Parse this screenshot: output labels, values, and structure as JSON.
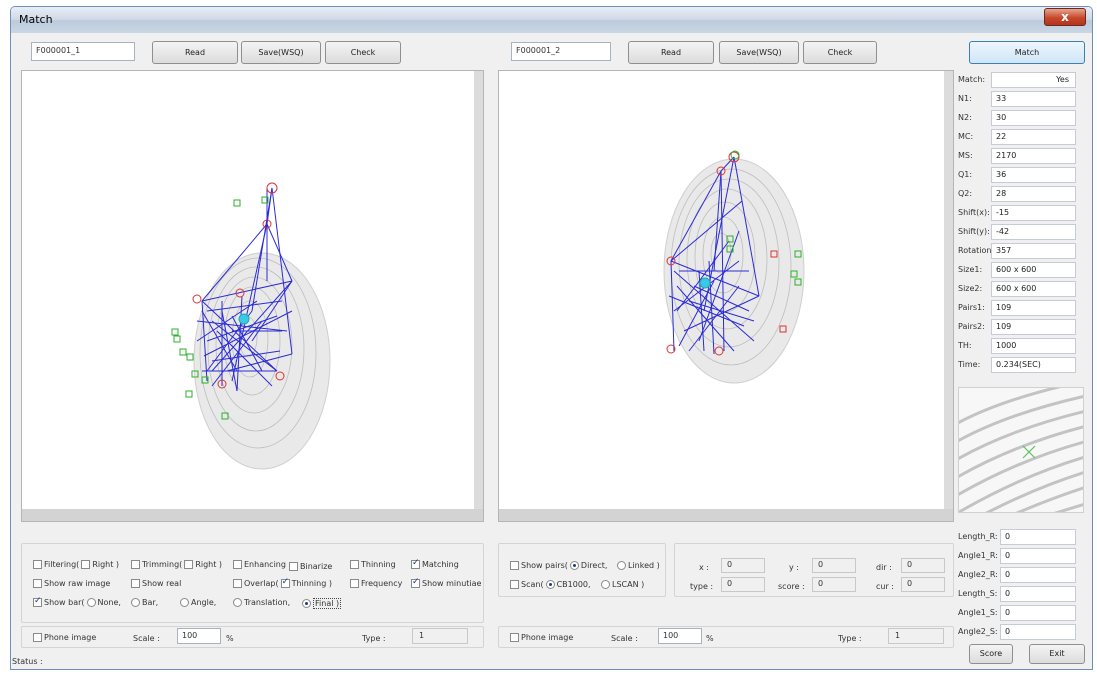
{
  "window": {
    "title": "Match",
    "close_label": "x"
  },
  "left": {
    "filename": "F000001_1",
    "read_label": "Read",
    "save_label": "Save(WSQ)",
    "check_label": "Check",
    "options": {
      "filtering": "Filtering(",
      "filtering_right": "Right )",
      "trimming": "Trimming(",
      "trimming_right": "Right )",
      "enhancing": "Enhancing",
      "binarize": "Binarize",
      "thinning": "Thinning",
      "matching": "Matching",
      "show_raw": "Show raw image",
      "show_real": "Show real",
      "overlap": "Overlap(",
      "overlap_thinning": "Thinning )",
      "frequency": "Frequency",
      "show_minutiae": "Show minutiae",
      "show_bar": "Show bar(",
      "none": "None,",
      "bar": "Bar,",
      "angle": "Angle,",
      "translation": "Translation,",
      "final": "Final )"
    },
    "phone_image": "Phone image",
    "scale_label": "Scale :",
    "scale_value": "100",
    "scale_unit": "%",
    "type_label": "Type :",
    "type_value": "1"
  },
  "right": {
    "filename": "F000001_2",
    "read_label": "Read",
    "save_label": "Save(WSQ)",
    "check_label": "Check",
    "show_pairs": "Show pairs(",
    "direct": "Direct,",
    "linked": "Linked )",
    "scan": "Scan(",
    "cb1000": "CB1000,",
    "lscan": "LSCAN )",
    "x_label": "x :",
    "x_value": "0",
    "y_label": "y :",
    "y_value": "0",
    "dir_label": "dir :",
    "dir_value": "0",
    "type_label2": "type :",
    "type_value2": "0",
    "score_label": "score :",
    "score_value": "0",
    "cur_label": "cur :",
    "cur_value": "0",
    "phone_image": "Phone image",
    "scale_label": "Scale :",
    "scale_value": "100",
    "scale_unit": "%",
    "type_label": "Type :",
    "type_value": "1"
  },
  "results": {
    "match_button": "Match",
    "rows": [
      {
        "label": "Match:",
        "value": "Yes"
      },
      {
        "label": "N1:",
        "value": "33"
      },
      {
        "label": "N2:",
        "value": "30"
      },
      {
        "label": "MC:",
        "value": "22"
      },
      {
        "label": "MS:",
        "value": "2170"
      },
      {
        "label": "Q1:",
        "value": "36"
      },
      {
        "label": "Q2:",
        "value": "28"
      },
      {
        "label": "Shift(x):",
        "value": "-15"
      },
      {
        "label": "Shift(y):",
        "value": "-42"
      },
      {
        "label": "Rotation:",
        "value": "357"
      },
      {
        "label": "Size1:",
        "value": "600 x 600"
      },
      {
        "label": "Size2:",
        "value": "600 x 600"
      },
      {
        "label": "Pairs1:",
        "value": "109"
      },
      {
        "label": "Pairs2:",
        "value": "109"
      },
      {
        "label": "TH:",
        "value": "1000"
      },
      {
        "label": "Time:",
        "value": "0.234(SEC)"
      }
    ],
    "lower_rows": [
      {
        "label": "Length_R:",
        "value": "0"
      },
      {
        "label": "Angle1_R:",
        "value": "0"
      },
      {
        "label": "Angle2_R:",
        "value": "0"
      },
      {
        "label": "Length_S:",
        "value": "0"
      },
      {
        "label": "Angle1_S:",
        "value": "0"
      },
      {
        "label": "Angle2_S:",
        "value": "0"
      }
    ],
    "score_button": "Score",
    "exit_button": "Exit"
  },
  "status": {
    "label": "Status :"
  }
}
